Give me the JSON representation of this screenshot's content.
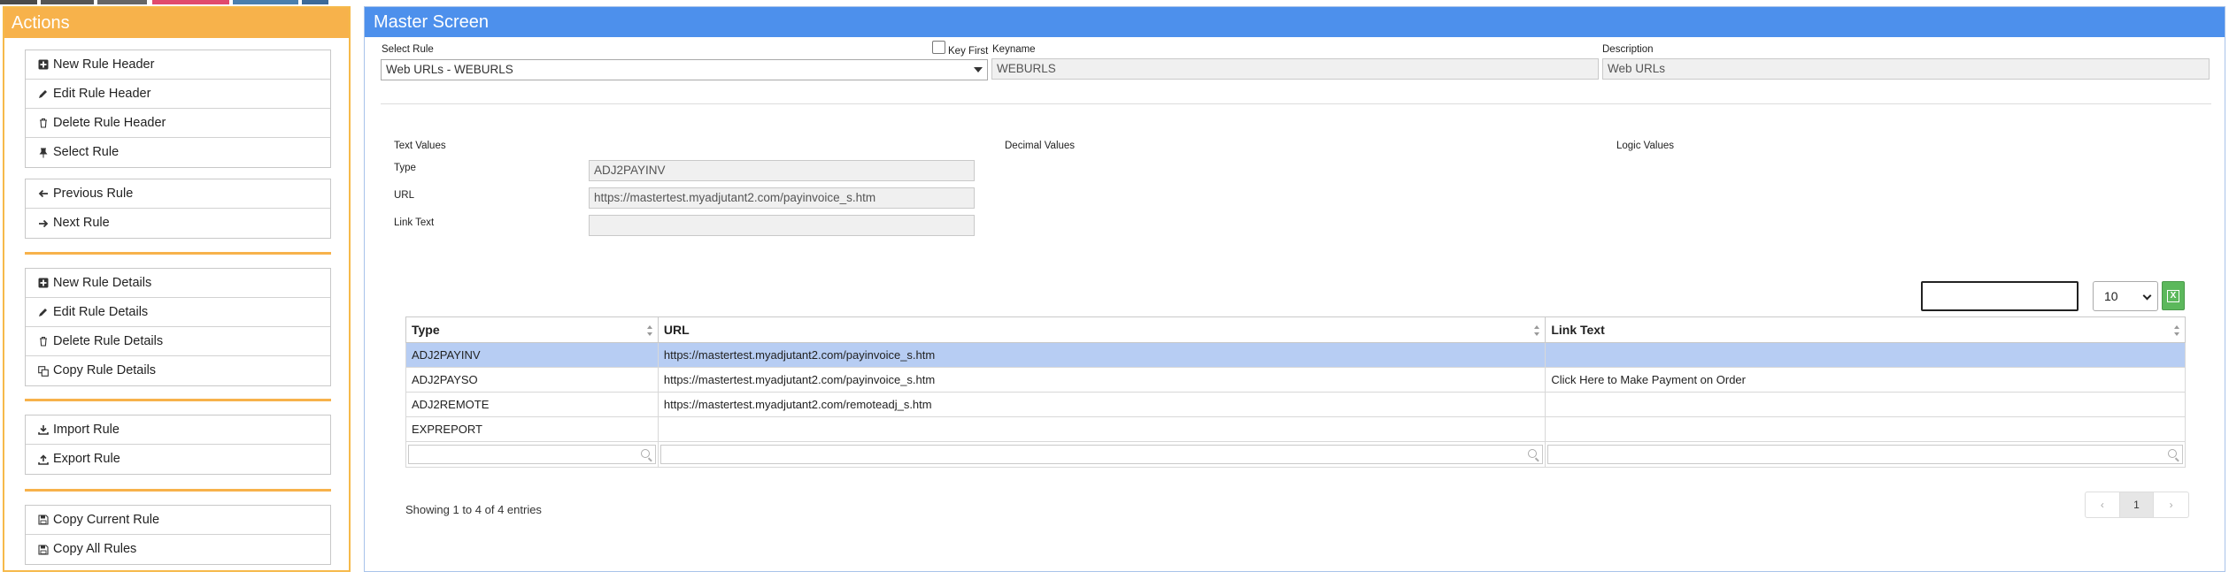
{
  "colors": {
    "actions_accent": "#f7b24b",
    "master_accent": "#4d90ec",
    "selected_row": "#b7cdf3",
    "excel_button": "#5cb85c"
  },
  "actions": {
    "title": "Actions",
    "groups": [
      [
        {
          "label": "New Rule Header",
          "icon": "plus-square-icon"
        },
        {
          "label": "Edit Rule Header",
          "icon": "pencil-icon"
        },
        {
          "label": "Delete Rule Header",
          "icon": "trash-icon"
        },
        {
          "label": "Select Rule",
          "icon": "pin-icon"
        }
      ],
      [
        {
          "label": "Previous Rule",
          "icon": "arrow-left-icon"
        },
        {
          "label": "Next Rule",
          "icon": "arrow-right-icon"
        }
      ],
      [
        {
          "label": "New Rule Details",
          "icon": "plus-square-icon"
        },
        {
          "label": "Edit Rule Details",
          "icon": "pencil-icon"
        },
        {
          "label": "Delete Rule Details",
          "icon": "trash-icon"
        },
        {
          "label": "Copy Rule Details",
          "icon": "copy-icon"
        }
      ],
      [
        {
          "label": "Import Rule",
          "icon": "download-icon"
        },
        {
          "label": "Export Rule",
          "icon": "upload-icon"
        }
      ],
      [
        {
          "label": "Copy Current Rule",
          "icon": "save-icon"
        },
        {
          "label": "Copy All Rules",
          "icon": "save-icon"
        }
      ]
    ]
  },
  "master": {
    "title": "Master Screen",
    "select_rule_label": "Select Rule",
    "select_rule_value": "Web URLs - WEBURLS",
    "key_first_label": "Key First",
    "keyname_label": "Keyname",
    "keyname_value": "WEBURLS",
    "description_label": "Description",
    "description_value": "Web URLs",
    "text_values_label": "Text Values",
    "decimal_values_label": "Decimal Values",
    "logic_values_label": "Logic Values",
    "type_label": "Type",
    "type_value": "ADJ2PAYINV",
    "url_label": "URL",
    "url_value": "https://mastertest.myadjutant2.com/payinvoice_s.htm",
    "link_text_label": "Link Text",
    "link_text_value": ""
  },
  "table": {
    "page_length": "10",
    "columns": [
      "Type",
      "URL",
      "Link Text"
    ],
    "rows": [
      [
        "ADJ2PAYINV",
        "https://mastertest.myadjutant2.com/payinvoice_s.htm",
        ""
      ],
      [
        "ADJ2PAYSO",
        "https://mastertest.myadjutant2.com/payinvoice_s.htm",
        "Click Here to Make Payment on Order"
      ],
      [
        "ADJ2REMOTE",
        "https://mastertest.myadjutant2.com/remoteadj_s.htm",
        ""
      ],
      [
        "EXPREPORT",
        "",
        ""
      ]
    ],
    "selected_row": 0,
    "info": "Showing 1 to 4 of 4 entries",
    "pager": {
      "prev": "‹",
      "current": "1",
      "next": "›"
    }
  }
}
